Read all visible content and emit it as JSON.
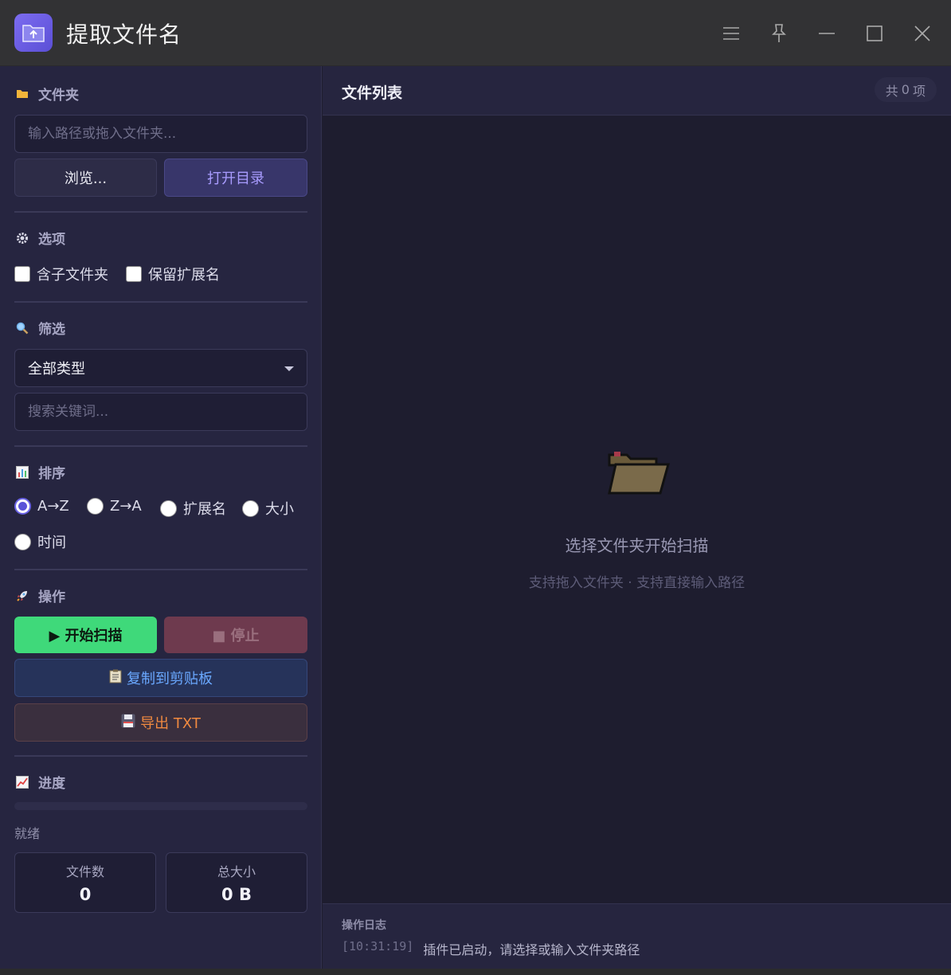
{
  "app": {
    "title": "提取文件名",
    "accent": "#6a63e6"
  },
  "folder": {
    "heading": "文件夹",
    "placeholder": "输入路径或拖入文件夹...",
    "browse_label": "浏览...",
    "open_label": "打开目录"
  },
  "options": {
    "heading": "选项",
    "include_subfolders": "含子文件夹",
    "keep_extension": "保留扩展名"
  },
  "filter": {
    "heading": "筛选",
    "type_selected": "全部类型",
    "search_placeholder": "搜索关键词..."
  },
  "sort": {
    "heading": "排序",
    "options": [
      "A→Z",
      "Z→A",
      "扩展名",
      "大小",
      "时间"
    ],
    "selected": "A→Z"
  },
  "actions": {
    "heading": "操作",
    "start_label": "▶ 开始扫描",
    "stop_label": "■ 停止",
    "copy_label": "复制到剪贴板",
    "export_label": "导出 TXT"
  },
  "progress": {
    "heading": "进度",
    "value": 0,
    "status": "就绪"
  },
  "stats": {
    "files_label": "文件数",
    "files_value": "0",
    "size_label": "总大小",
    "size_value": "0 B"
  },
  "list": {
    "title": "文件列表",
    "count_prefix": "共",
    "count": "0",
    "count_suffix": "项",
    "empty_title": "选择文件夹开始扫描",
    "empty_sub": "支持拖入文件夹 · 支持直接输入路径"
  },
  "log": {
    "title": "操作日志",
    "time": "[10:31:19]",
    "message": "插件已启动，请选择或输入文件夹路径"
  }
}
